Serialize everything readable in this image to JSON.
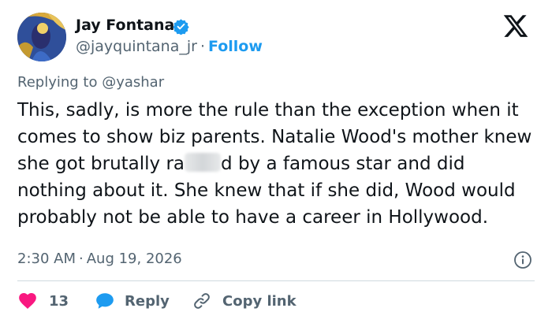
{
  "author": {
    "name": "Jay Fontana",
    "handle": "@jayquintana_jr",
    "separator": "·",
    "follow_label": "Follow"
  },
  "tweet": {
    "replying_to": "Replying to @yashar",
    "text_part1": "This, sadly, is more the rule than the exception when it comes to show biz parents.  Natalie Wood's mother knew she got brutally ra",
    "text_part2": "d by a famous star and did nothing about it.  She knew that if she did, Wood would probably not be able to have a career in Hollywood.",
    "time": "2:30 AM",
    "date": "Aug 19, 2026",
    "separator": "·"
  },
  "actions": {
    "likes_count": "13",
    "reply_label": "Reply",
    "copy_link_label": "Copy link"
  },
  "colors": {
    "accent": "#1d9bf0",
    "like": "#f91880",
    "text": "#0f1419",
    "muted": "#536471"
  },
  "icons": [
    "verified-badge-icon",
    "x-logo-icon",
    "info-icon",
    "heart-icon",
    "reply-bubble-icon",
    "link-icon"
  ]
}
